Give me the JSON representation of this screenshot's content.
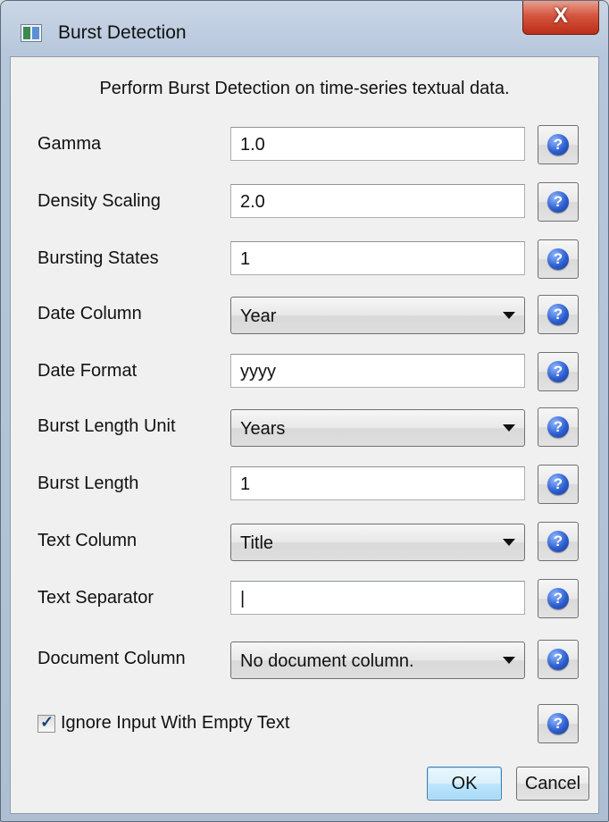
{
  "window": {
    "title": "Burst Detection",
    "close_label": "X"
  },
  "description": "Perform Burst Detection on time-series textual data.",
  "fields": [
    {
      "label": "Gamma",
      "type": "text",
      "value": "1.0"
    },
    {
      "label": "Density Scaling",
      "type": "text",
      "value": "2.0"
    },
    {
      "label": "Bursting States",
      "type": "text",
      "value": "1"
    },
    {
      "label": "Date Column",
      "type": "select",
      "value": "Year"
    },
    {
      "label": "Date Format",
      "type": "text",
      "value": "yyyy"
    },
    {
      "label": "Burst Length Unit",
      "type": "select",
      "value": "Years"
    },
    {
      "label": "Burst Length",
      "type": "text",
      "value": "1"
    },
    {
      "label": "Text Column",
      "type": "select",
      "value": "Title"
    },
    {
      "label": "Text Separator",
      "type": "text",
      "value": "|"
    },
    {
      "label": "Document Column",
      "type": "select",
      "value": "No document column."
    }
  ],
  "ignore_empty": {
    "label": "Ignore Input With Empty Text",
    "checked": true,
    "checkmark": "✓"
  },
  "help_glyph": "?",
  "buttons": {
    "ok": "OK",
    "cancel": "Cancel"
  },
  "colors": {
    "title_bar": "#b7c7db",
    "close_button": "#d4553f",
    "help_icon": "#2d5fd0",
    "ok_button": "#bee6fd"
  }
}
